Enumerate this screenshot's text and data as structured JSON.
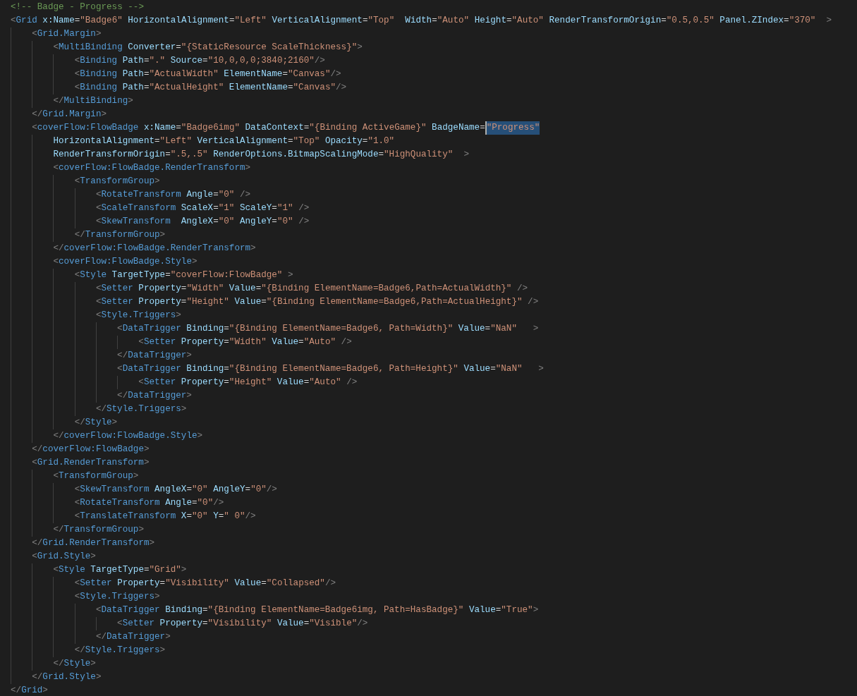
{
  "editor": {
    "lines": [
      {
        "text": "<!-- Badge - Progress -->"
      },
      {
        "text": "<Grid x:Name=\"Badge6\" HorizontalAlignment=\"Left\" VerticalAlignment=\"Top\"  Width=\"Auto\" Height=\"Auto\" RenderTransformOrigin=\"0.5,0.5\" Panel.ZIndex=\"370\"  >",
        "children": [
          {
            "text": "<Grid.Margin>",
            "children": [
              {
                "text": "<MultiBinding Converter=\"{StaticResource ScaleThickness}\">",
                "children": [
                  {
                    "text": "<Binding Path=\".\" Source=\"10,0,0,0;3840;2160\"/>"
                  },
                  {
                    "text": "<Binding Path=\"ActualWidth\" ElementName=\"Canvas\"/>"
                  },
                  {
                    "text": "<Binding Path=\"ActualHeight\" ElementName=\"Canvas\"/>"
                  }
                ]
              },
              {
                "text": "</MultiBinding>"
              }
            ]
          },
          {
            "text": "</Grid.Margin>"
          },
          {
            "text": "<coverFlow:FlowBadge x:Name=\"Badge6img\" DataContext=\"{Binding ActiveGame}\" BadgeName=",
            "selected_text": "\"Progress\"",
            "children": [
              {
                "text": "HorizontalAlignment=\"Left\" VerticalAlignment=\"Top\" Opacity=\"1.0\""
              },
              {
                "text": "RenderTransformOrigin=\".5,.5\" RenderOptions.BitmapScalingMode=\"HighQuality\"  >"
              },
              {
                "text": "<coverFlow:FlowBadge.RenderTransform>",
                "children": [
                  {
                    "text": "<TransformGroup>",
                    "children": [
                      {
                        "text": "<RotateTransform Angle=\"0\" />"
                      },
                      {
                        "text": "<ScaleTransform ScaleX=\"1\" ScaleY=\"1\" />"
                      },
                      {
                        "text": "<SkewTransform  AngleX=\"0\" AngleY=\"0\" />"
                      }
                    ]
                  },
                  {
                    "text": "</TransformGroup>"
                  }
                ]
              },
              {
                "text": "</coverFlow:FlowBadge.RenderTransform>"
              },
              {
                "text": "<coverFlow:FlowBadge.Style>",
                "children": [
                  {
                    "text": "<Style TargetType=\"coverFlow:FlowBadge\" >",
                    "children": [
                      {
                        "text": "<Setter Property=\"Width\" Value=\"{Binding ElementName=Badge6,Path=ActualWidth}\" />"
                      },
                      {
                        "text": "<Setter Property=\"Height\" Value=\"{Binding ElementName=Badge6,Path=ActualHeight}\" />"
                      },
                      {
                        "text": "<Style.Triggers>",
                        "children": [
                          {
                            "text": "<DataTrigger Binding=\"{Binding ElementName=Badge6, Path=Width}\" Value=\"NaN\"   >",
                            "children": [
                              {
                                "text": "<Setter Property=\"Width\" Value=\"Auto\" />"
                              }
                            ]
                          },
                          {
                            "text": "</DataTrigger>"
                          },
                          {
                            "text": "<DataTrigger Binding=\"{Binding ElementName=Badge6, Path=Height}\" Value=\"NaN\"   >",
                            "children": [
                              {
                                "text": "<Setter Property=\"Height\" Value=\"Auto\" />"
                              }
                            ]
                          },
                          {
                            "text": "</DataTrigger>"
                          }
                        ]
                      },
                      {
                        "text": "</Style.Triggers>"
                      }
                    ]
                  },
                  {
                    "text": "</Style>"
                  }
                ]
              },
              {
                "text": "</coverFlow:FlowBadge.Style>"
              }
            ]
          },
          {
            "text": "</coverFlow:FlowBadge>"
          },
          {
            "text": "<Grid.RenderTransform>",
            "children": [
              {
                "text": "<TransformGroup>",
                "children": [
                  {
                    "text": "<SkewTransform AngleX=\"0\" AngleY=\"0\"/>"
                  },
                  {
                    "text": "<RotateTransform Angle=\"0\"/>"
                  },
                  {
                    "text": "<TranslateTransform X=\"0\" Y=\" 0\"/>"
                  }
                ]
              },
              {
                "text": "</TransformGroup>"
              }
            ]
          },
          {
            "text": "</Grid.RenderTransform>"
          },
          {
            "text": "<Grid.Style>",
            "children": [
              {
                "text": "<Style TargetType=\"Grid\">",
                "children": [
                  {
                    "text": "<Setter Property=\"Visibility\" Value=\"Collapsed\"/>"
                  },
                  {
                    "text": "<Style.Triggers>",
                    "children": [
                      {
                        "text": "<DataTrigger Binding=\"{Binding ElementName=Badge6img, Path=HasBadge}\" Value=\"True\">",
                        "children": [
                          {
                            "text": "<Setter Property=\"Visibility\" Value=\"Visible\"/>"
                          }
                        ]
                      },
                      {
                        "text": "</DataTrigger>"
                      }
                    ]
                  },
                  {
                    "text": "</Style.Triggers>"
                  }
                ]
              },
              {
                "text": "</Style>"
              }
            ]
          },
          {
            "text": "</Grid.Style>"
          }
        ]
      },
      {
        "text": "</Grid>"
      }
    ]
  }
}
